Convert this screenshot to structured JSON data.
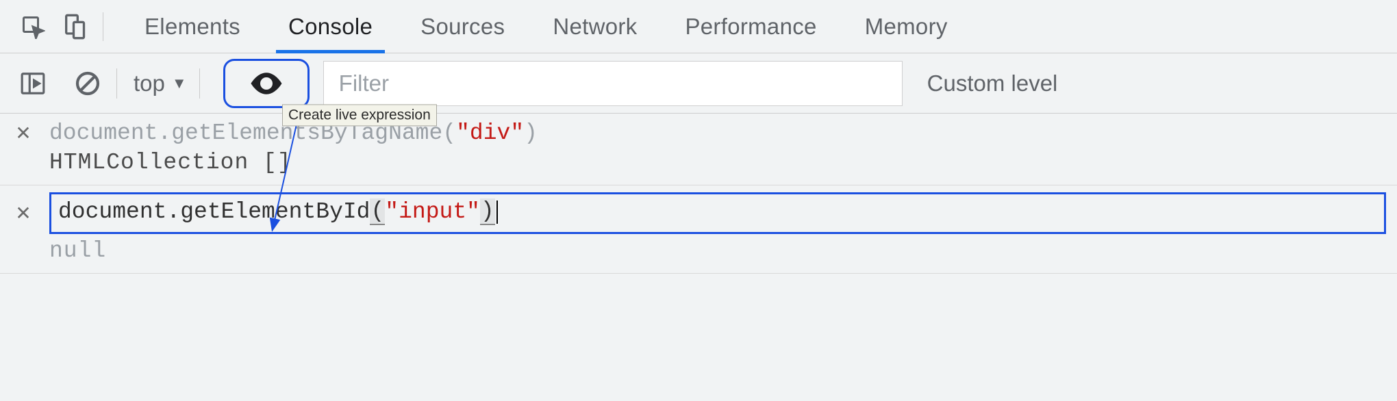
{
  "tabs": {
    "items": [
      "Elements",
      "Console",
      "Sources",
      "Network",
      "Performance",
      "Memory"
    ],
    "active": "Console"
  },
  "toolbar": {
    "context": "top",
    "filter_placeholder": "Filter",
    "levels_label": "Custom level",
    "tooltip": "Create live expression"
  },
  "live_expressions": [
    {
      "pre": "document.getElementsByTagName(",
      "arg": "\"div\"",
      "post": ")",
      "result": "HTMLCollection []",
      "editing": false
    },
    {
      "pre": "document.getElementById",
      "open_paren": "(",
      "arg": "\"input\"",
      "close_paren": ")",
      "result": "null",
      "editing": true
    }
  ]
}
